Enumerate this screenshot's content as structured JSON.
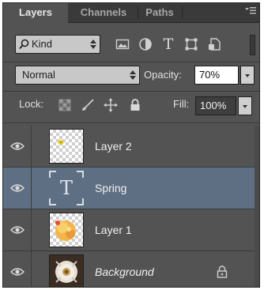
{
  "tabs": [
    {
      "label": "Layers",
      "active": true
    },
    {
      "label": "Channels",
      "active": false
    },
    {
      "label": "Paths",
      "active": false
    }
  ],
  "panel_menu_icon": "panel-menu-icon",
  "filter": {
    "kind_label": "Kind",
    "icons": [
      "pixel-filter-icon",
      "adjustment-filter-icon",
      "type-filter-icon",
      "shape-filter-icon",
      "smart-object-filter-icon"
    ],
    "type_glyph": "T"
  },
  "blend": {
    "mode": "Normal",
    "opacity_label": "Opacity:",
    "opacity_value": "70%"
  },
  "lock": {
    "label": "Lock:",
    "icons": [
      "lock-transparent-pixels-icon",
      "lock-image-pixels-icon",
      "lock-position-icon",
      "lock-all-icon"
    ],
    "fill_label": "Fill:",
    "fill_value": "100%"
  },
  "layers": [
    {
      "name": "Layer 2",
      "selected": false,
      "type": "pixel"
    },
    {
      "name": "Spring",
      "selected": true,
      "type": "text",
      "glyph": "T"
    },
    {
      "name": "Layer 1",
      "selected": false,
      "type": "pixel"
    },
    {
      "name": "Background",
      "selected": false,
      "type": "background",
      "locked": true
    }
  ],
  "colors": {
    "panel_bg": "#535353",
    "selected_row": "#5f6f83",
    "tab_bar": "#3a3a3a"
  }
}
